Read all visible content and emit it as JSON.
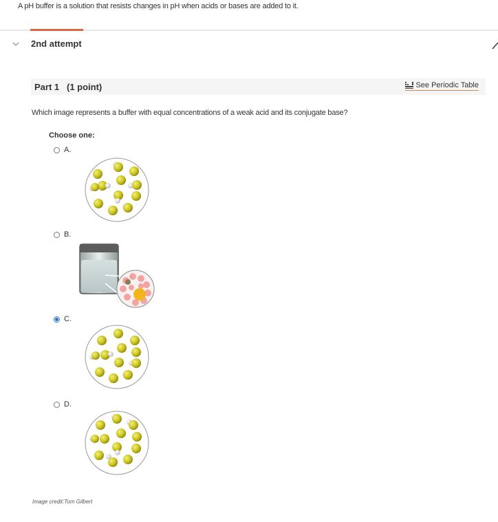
{
  "intro_text": "A pH buffer is a solution that resists changes in pH when acids or bases are added to it.",
  "attempt_label": "2nd attempt",
  "part": {
    "title": "Part 1",
    "points": "(1 point)",
    "periodic_link": "See Periodic Table",
    "periodic_icon": "periodic-table-icon"
  },
  "question": "Which image represents a buffer with equal concentrations of a weak acid and its conjugate base?",
  "choose_label": "Choose one:",
  "options": [
    {
      "letter": "A.",
      "selected": false,
      "image": "particle-circle-a"
    },
    {
      "letter": "B.",
      "selected": false,
      "image": "beaker-zoom"
    },
    {
      "letter": "C.",
      "selected": true,
      "image": "particle-circle-c"
    },
    {
      "letter": "D.",
      "selected": false,
      "image": "particle-circle-d"
    }
  ],
  "credit": "Image credit:Tom Gilbert",
  "colors": {
    "accent_tab": "#e0623f",
    "radio_selected": "#2a6fd6",
    "link_underline": "#d88b45",
    "particle_yellow": "#c9c41f",
    "particle_white": "#f2f2f2"
  }
}
